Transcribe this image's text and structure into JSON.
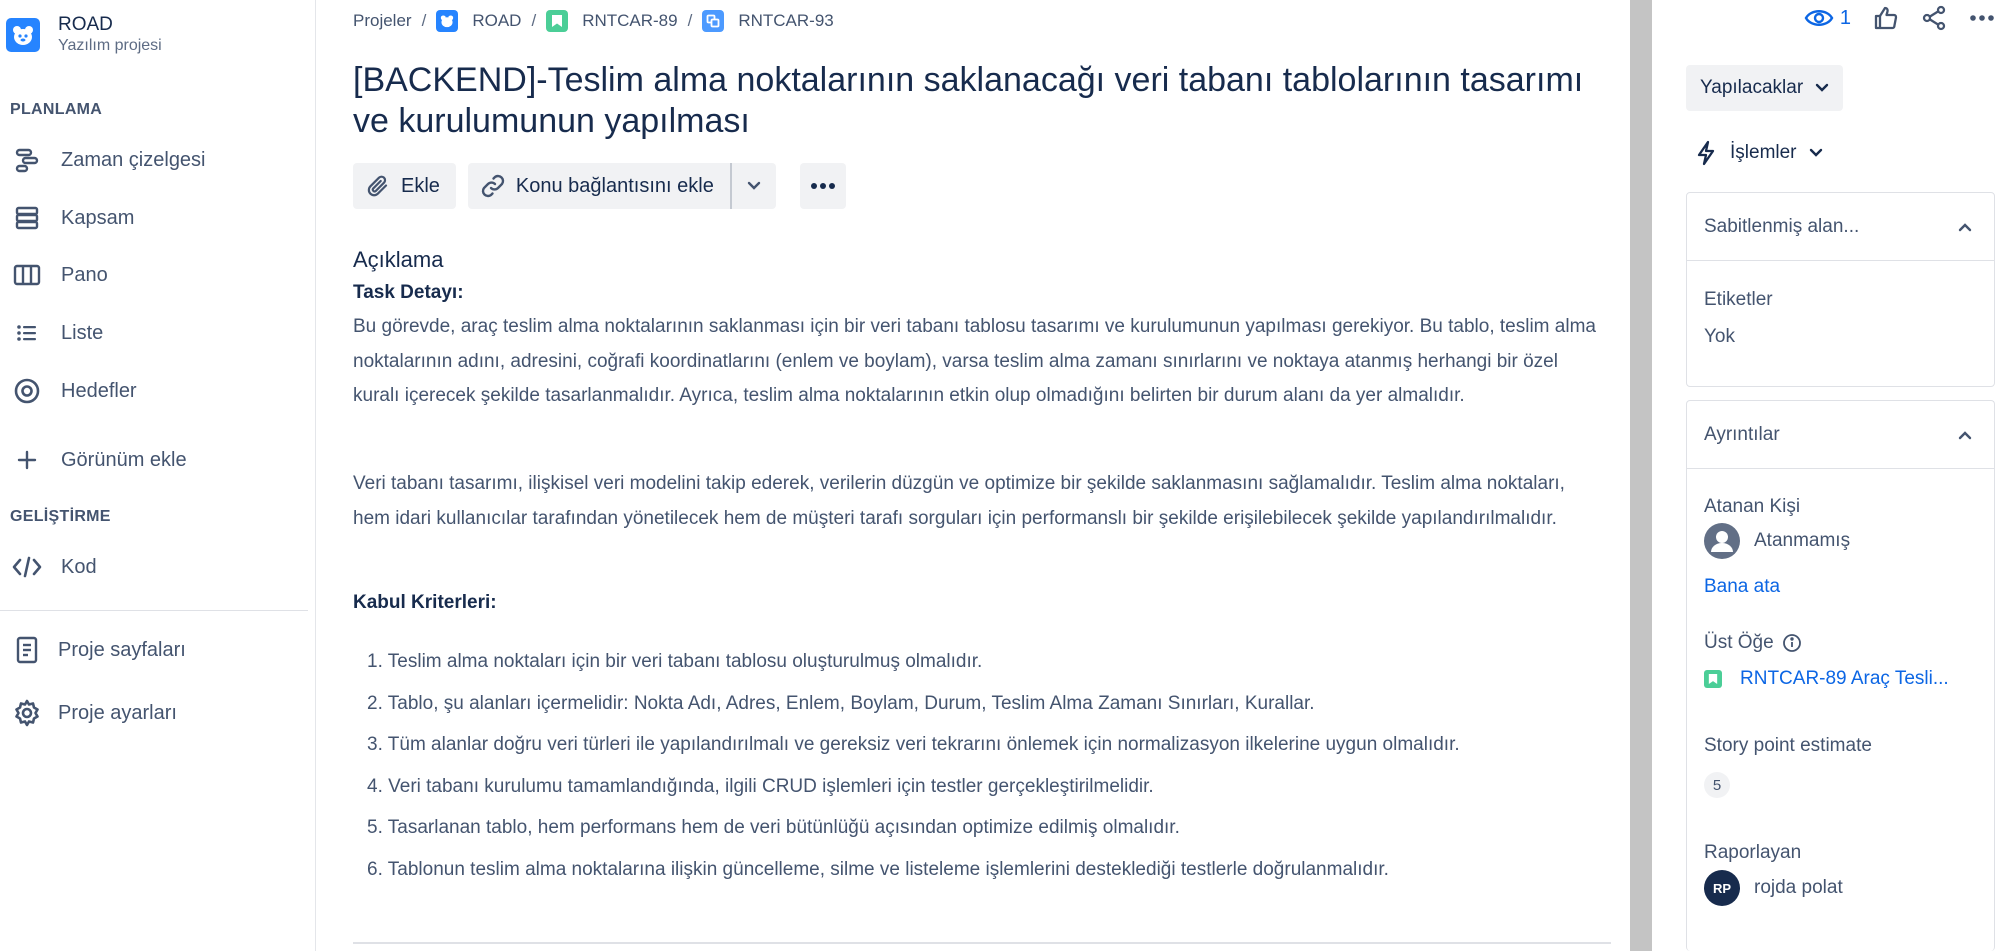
{
  "project": {
    "name": "ROAD",
    "type": "Yazılım projesi"
  },
  "sidebar": {
    "planning_title": "PLANLAMA",
    "planning_items": [
      {
        "label": "Zaman çizelgesi",
        "icon": "timeline-icon"
      },
      {
        "label": "Kapsam",
        "icon": "backlog-icon"
      },
      {
        "label": "Pano",
        "icon": "board-icon"
      },
      {
        "label": "Liste",
        "icon": "list-icon"
      },
      {
        "label": "Hedefler",
        "icon": "goals-icon"
      }
    ],
    "add_view": "Görünüm ekle",
    "dev_title": "GELİŞTİRME",
    "dev_items": [
      {
        "label": "Kod",
        "icon": "code-icon"
      }
    ],
    "footer_items": [
      {
        "label": "Proje sayfaları",
        "icon": "pages-icon"
      },
      {
        "label": "Proje ayarları",
        "icon": "settings-icon"
      }
    ]
  },
  "breadcrumb": [
    {
      "label": "Projeler"
    },
    {
      "label": "ROAD"
    },
    {
      "label": "RNTCAR-89"
    },
    {
      "label": "RNTCAR-93"
    }
  ],
  "issue": {
    "title": "[BACKEND]-Teslim alma noktalarının saklanacağı veri tabanı tablolarının tasarımı ve kurulumunun yapılması"
  },
  "toolbar": {
    "attach": "Ekle",
    "link_issue": "Konu bağlantısını ekle"
  },
  "description": {
    "heading": "Açıklama",
    "task_heading": "Task Detayı:",
    "paragraph1": "Bu görevde, araç teslim alma noktalarının saklanması için bir veri tabanı tablosu tasarımı ve kurulumunun yapılması gerekiyor. Bu tablo, teslim alma noktalarının adını, adresini, coğrafi koordinatlarını (enlem ve boylam), varsa teslim alma zamanı sınırlarını ve noktaya atanmış herhangi bir özel kuralı içerecek şekilde tasarlanmalıdır. Ayrıca, teslim alma noktalarının etkin olup olmadığını belirten bir durum alanı da yer almalıdır.",
    "paragraph2": "Veri tabanı tasarımı, ilişkisel veri modelini takip ederek, verilerin düzgün ve optimize bir şekilde saklanmasını sağlamalıdır. Teslim alma noktaları, hem idari kullanıcılar tarafından yönetilecek hem de müşteri tarafı sorguları için performanslı bir şekilde erişilebilecek şekilde yapılandırılmalıdır.",
    "criteria_heading": "Kabul Kriterleri:",
    "criteria": [
      "1. Teslim alma noktaları için bir veri tabanı tablosu oluşturulmuş olmalıdır.",
      "2. Tablo, şu alanları içermelidir: Nokta Adı, Adres, Enlem, Boylam, Durum, Teslim Alma Zamanı Sınırları, Kurallar.",
      "3. Tüm alanlar doğru veri türleri ile yapılandırılmalı ve gereksiz veri tekrarını önlemek için normalizasyon ilkelerine uygun olmalıdır.",
      "4. Veri tabanı kurulumu tamamlandığında, ilgili CRUD işlemleri için testler gerçekleştirilmelidir.",
      "5. Tasarlanan tablo, hem performans hem de veri bütünlüğü açısından optimize edilmiş olmalıdır.",
      "6. Tablonun teslim alma noktalarına ilişkin güncelleme, silme ve listeleme işlemlerini desteklediği testlerle doğrulanmalıdır."
    ]
  },
  "right_panel": {
    "watchers_count": "1",
    "status": "Yapılacaklar",
    "actions": "İşlemler",
    "pinned": {
      "title": "Sabitlenmiş alan...",
      "labels_label": "Etiketler",
      "labels_value": "Yok"
    },
    "details": {
      "title": "Ayrıntılar",
      "assignee_label": "Atanan Kişi",
      "assignee_value": "Atanmamış",
      "assign_to_me": "Bana ata",
      "parent_label": "Üst Öğe",
      "parent_value": "RNTCAR-89 Araç Tesli...",
      "story_points_label": "Story point estimate",
      "story_points_value": "5",
      "reporter_label": "Raporlayan",
      "reporter_initials": "RP",
      "reporter_name": "rojda polat"
    }
  },
  "colors": {
    "brand_blue": "#2684ff",
    "link_blue": "#0c66e4",
    "story_green": "#4bce97",
    "subtask_blue": "#4c9aff",
    "text_dark": "#172b4d",
    "text_muted": "#44546f"
  }
}
